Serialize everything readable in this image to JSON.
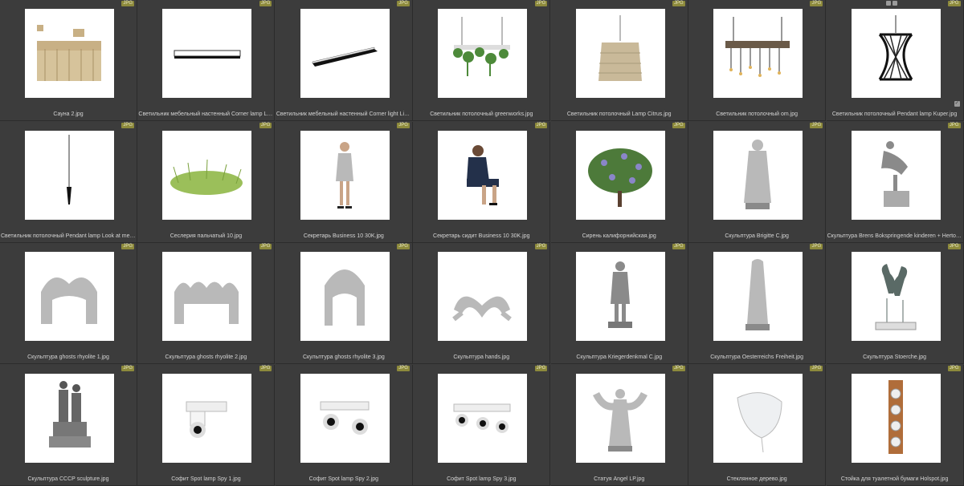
{
  "badge_label": "JPG",
  "items": [
    {
      "caption": "Сауна 2.jpg",
      "icon": "sauna"
    },
    {
      "caption": "Светильник мебельный настенный Corner lamp Linear U...",
      "icon": "linear-lamp"
    },
    {
      "caption": "Светильник мебельный настенный Corner light Linear US...",
      "icon": "linear-lamp-angled"
    },
    {
      "caption": "Светильник потолочный greenworks.jpg",
      "icon": "plant-chandelier"
    },
    {
      "caption": "Светильник потолочный Lamp Citrus.jpg",
      "icon": "rattan-lamp"
    },
    {
      "caption": "Светильник потолочный om.jpg",
      "icon": "beam-chandelier"
    },
    {
      "caption": "Светильник потолочный Pendant lamp Kuper.jpg",
      "icon": "wire-pendant",
      "selected": true
    },
    {
      "caption": "Светильник потолочный Pendant lamp Look at me.jpg",
      "icon": "drop-pendant"
    },
    {
      "caption": "Сеслерия пальчатый 10.jpg",
      "icon": "grass"
    },
    {
      "caption": "Секретарь Business 10 30K.jpg",
      "icon": "woman-standing"
    },
    {
      "caption": "Секретарь сидит Business 10 30K.jpg",
      "icon": "woman-sitting"
    },
    {
      "caption": "Сирень калифорнийская.jpg",
      "icon": "lilac-bush"
    },
    {
      "caption": "Скульптура Brigitte C.jpg",
      "icon": "statue-nun"
    },
    {
      "caption": "Скульптура Brens Bokspringende kinderen + Hertogenbosc...",
      "icon": "statue-leapfrog"
    },
    {
      "caption": "Скульптура ghosts rhyolite 1.jpg",
      "icon": "ghost-arch"
    },
    {
      "caption": "Скульптура ghosts rhyolite 2.jpg",
      "icon": "ghost-group"
    },
    {
      "caption": "Скульптура ghosts rhyolite 3.jpg",
      "icon": "ghost-single"
    },
    {
      "caption": "Скульптура hands.jpg",
      "icon": "heart-hands"
    },
    {
      "caption": "Скульптура Kriegerdenkmal C.jpg",
      "icon": "statue-soldier"
    },
    {
      "caption": "Скульптура Oesterreichs Freiheit.jpg",
      "icon": "statue-hooded"
    },
    {
      "caption": "Скульптура Stoerche.jpg",
      "icon": "statue-storks"
    },
    {
      "caption": "Скульптура СССР sculpture.jpg",
      "icon": "statue-ussr"
    },
    {
      "caption": "Софит Spot lamp Spy 1.jpg",
      "icon": "spot-1"
    },
    {
      "caption": "Софит Spot lamp Spy 2.jpg",
      "icon": "spot-2"
    },
    {
      "caption": "Софит Spot lamp Spy 3.jpg",
      "icon": "spot-3"
    },
    {
      "caption": "Статуя Angel LP.jpg",
      "icon": "angel-statue"
    },
    {
      "caption": "Стеклянное дерево.jpg",
      "icon": "glass-leaf"
    },
    {
      "caption": "Стойка для туалетной бумаги Holspot.jpg",
      "icon": "tp-holder"
    }
  ]
}
